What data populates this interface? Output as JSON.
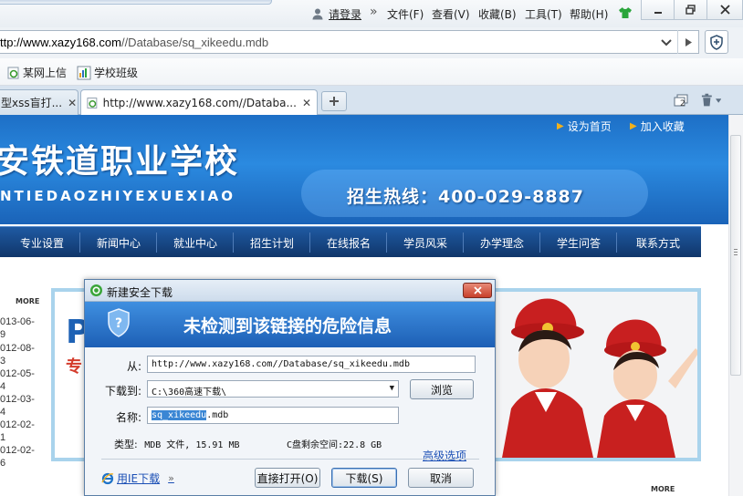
{
  "titlebar": {
    "login": "请登录",
    "more_glyph": "»",
    "menus": [
      "文件(F)",
      "查看(V)",
      "收藏(B)",
      "工具(T)",
      "帮助(H)"
    ]
  },
  "address": {
    "host_part": "ttp://www.xazy168.com",
    "path_part": "//Database/sq_xikeedu.mdb"
  },
  "favorites": [
    "某网上信",
    "学校班级"
  ],
  "tabs": [
    {
      "label": "型xss盲打..."
    },
    {
      "label": "http://www.xazy168.com//Databa..."
    }
  ],
  "tab_count_badge": "2",
  "page": {
    "top_links": [
      "设为首页",
      "加入收藏"
    ],
    "school_name": "安铁道职业学校",
    "school_pinyin": "NTIEDAOZHIYEXUEXIAO",
    "hotline": "招生热线：400-029-8887",
    "nav": [
      "专业设置",
      "新闻中心",
      "就业中心",
      "招生计划",
      "在线报名",
      "学员风采",
      "办学理念",
      "学生问答",
      "联系方式"
    ],
    "more_label": "MORE",
    "dates": [
      "013-06-\n9",
      "012-08-\n3",
      "012-05-\n4",
      "012-03-\n4",
      "012-02-\n1",
      "012-02-\n6"
    ],
    "photo_logo": "P",
    "photo_red_text": "专"
  },
  "dialog": {
    "title": "新建安全下载",
    "heading": "未检测到该链接的危险信息",
    "from_label": "从:",
    "from_value": "http://www.xazy168.com//Database/sq_xikeedu.mdb",
    "dest_label": "下载到:",
    "dest_value": "C:\\360高速下载\\",
    "browse_button": "浏览",
    "name_label": "名称:",
    "name_selected": "sq_xikeedu",
    "name_ext": ".mdb",
    "type_label": "类型:",
    "type_value": "MDB 文件, 15.91 MB",
    "free_space": "C盘剩余空间:22.8 GB",
    "advanced_link": "高级选项",
    "ie_link": "用IE下载",
    "open_button": "直接打开(O)",
    "download_button": "下载(S)",
    "cancel_button": "取消"
  }
}
